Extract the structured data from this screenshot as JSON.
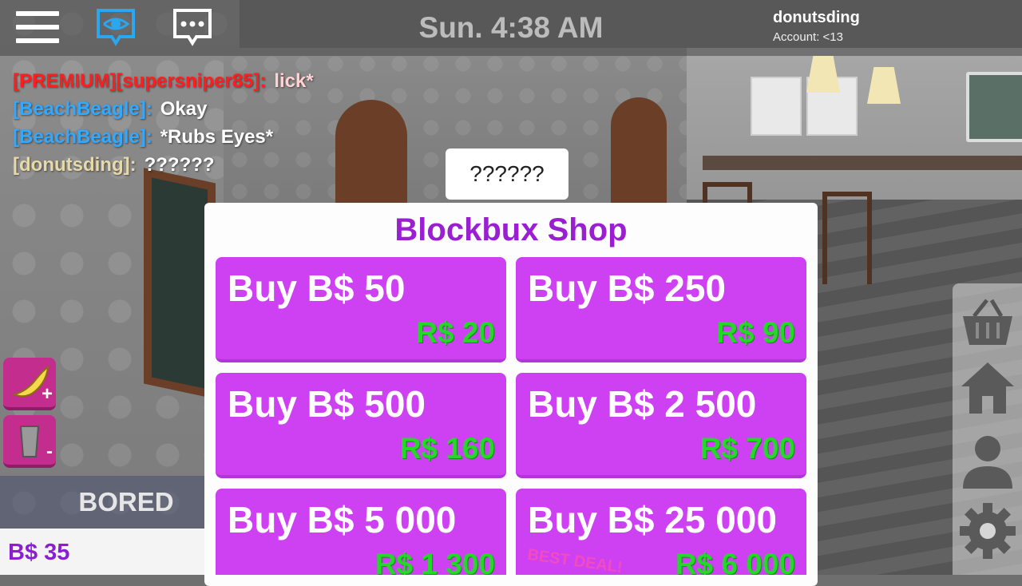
{
  "header": {
    "clock": "Sun. 4:38 AM",
    "username": "donutsding",
    "account": "Account: <13"
  },
  "chat": [
    {
      "name": "[PREMIUM][supersniper85]:",
      "message": "lick*",
      "style": "premium"
    },
    {
      "name": "[BeachBeagle]:",
      "message": "Okay",
      "style": "blue"
    },
    {
      "name": "[BeachBeagle]:",
      "message": "*Rubs Eyes*",
      "style": "blue"
    },
    {
      "name": "[donutsding]:",
      "message": "??????",
      "style": "tan"
    }
  ],
  "speech_bubble": "??????",
  "shop": {
    "title": "Blockbux Shop",
    "offers": [
      {
        "label": "Buy B$ 50",
        "price": "R$ 20"
      },
      {
        "label": "Buy B$ 250",
        "price": "R$ 90"
      },
      {
        "label": "Buy B$ 500",
        "price": "R$ 160"
      },
      {
        "label": "Buy B$ 2 500",
        "price": "R$ 700"
      },
      {
        "label": "Buy B$ 5 000",
        "price": "R$ 1 300"
      },
      {
        "label": "Buy B$ 25 000",
        "price": "R$ 6 000",
        "tag": "BEST DEAL!"
      }
    ]
  },
  "status": {
    "mood": "BORED",
    "money": "B$  35"
  },
  "needs": [
    {
      "icon": "banana-icon",
      "action": "+"
    },
    {
      "icon": "cup-icon",
      "action": "-"
    }
  ],
  "right_nav": [
    "basket-icon",
    "home-icon",
    "person-icon",
    "gear-icon"
  ],
  "colors": {
    "shop_title": "#9a1fd1",
    "offer_bg": "#cd41f3",
    "price_green": "#27d62b",
    "premium_red": "#ff1d1d",
    "chat_blue": "#33a8ff"
  }
}
